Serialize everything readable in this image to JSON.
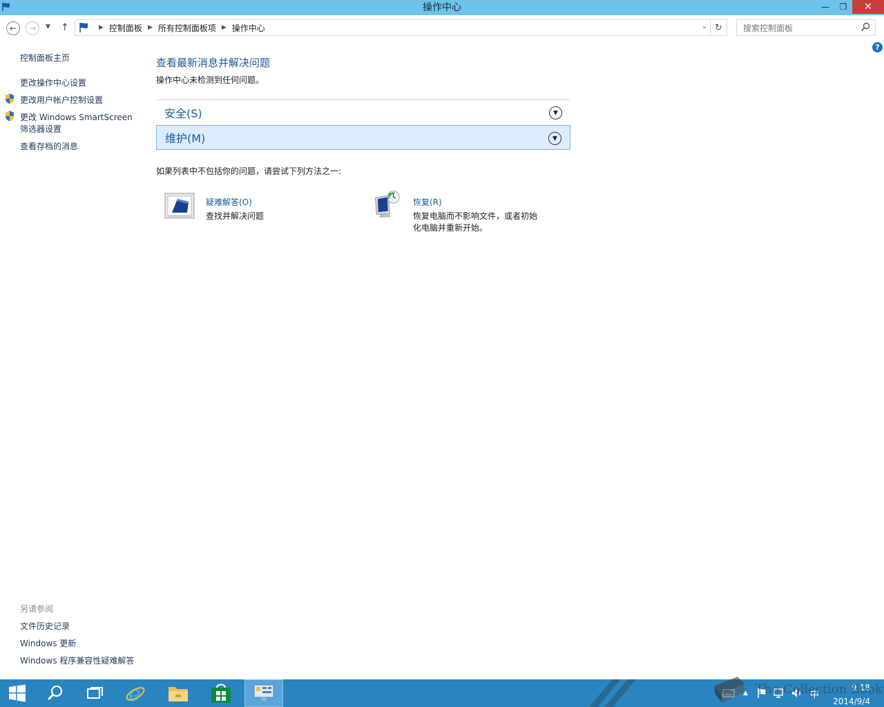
{
  "window": {
    "title": "操作中心"
  },
  "address": {
    "crumbs": [
      "控制面板",
      "所有控制面板项",
      "操作中心"
    ],
    "search_placeholder": "搜索控制面板"
  },
  "help": {
    "label": "?"
  },
  "leftnav": {
    "home": "控制面板主页",
    "links": [
      "更改操作中心设置",
      "更改用户帐户控制设置",
      "更改 Windows SmartScreen",
      "筛选器设置",
      "查看存档的消息"
    ],
    "see_also_heading": "另请参阅",
    "see_also": [
      "文件历史记录",
      "Windows 更新",
      "Windows 程序兼容性疑难解答"
    ]
  },
  "main": {
    "title": "查看最新消息并解决问题",
    "subtitle": "操作中心未检测到任何问题。",
    "sections": [
      "安全(S)",
      "维护(M)"
    ],
    "hint": "如果列表中不包括你的问题，请尝试下列方法之一:",
    "tools": [
      {
        "title": "疑难解答(O)",
        "desc": [
          "查找并解决问题"
        ]
      },
      {
        "title": "恢复(R)",
        "desc": [
          "恢复电脑而不影响文件，或者初始",
          "化电脑并重新开始。"
        ]
      }
    ]
  },
  "tray": {
    "ime": "中",
    "time": "9:18",
    "date": "2014/9/4"
  },
  "watermark": "The Collection Book",
  "colors": {
    "titlebar": "#6ec3ea",
    "taskbar": "#2a84c0",
    "link": "#1d5a96",
    "selected_section": "#dcecfc"
  }
}
